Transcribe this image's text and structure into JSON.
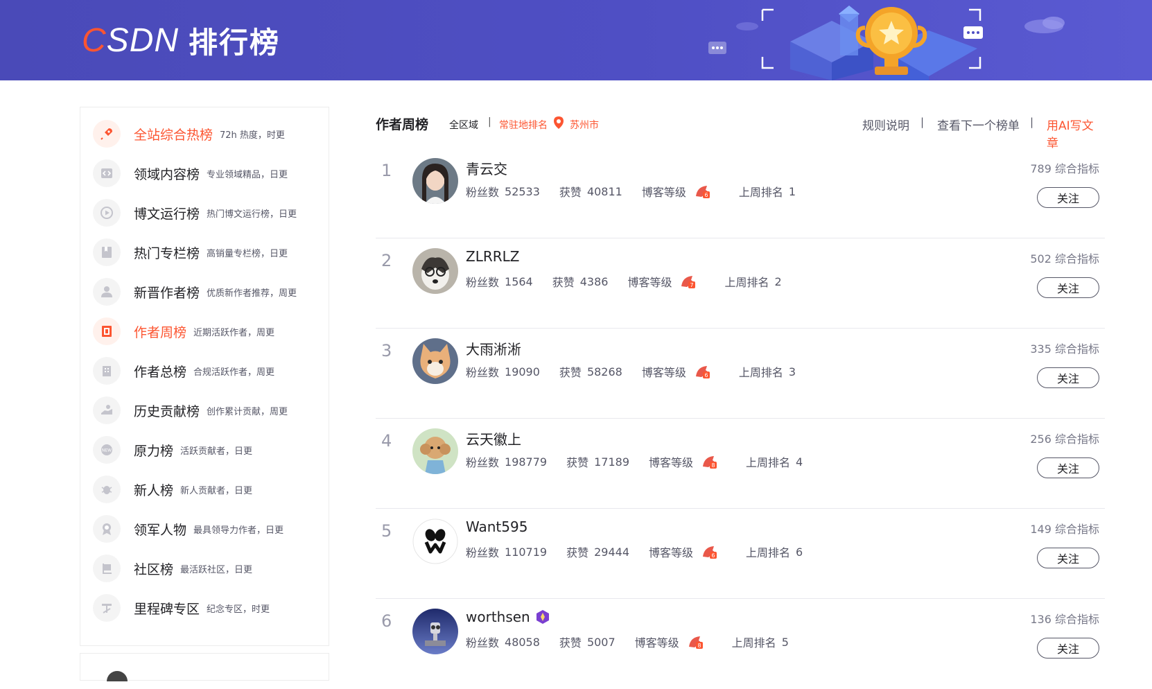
{
  "banner": {
    "logo_c": "C",
    "logo_rest": "SDN",
    "title": "排行榜"
  },
  "sidebar": {
    "items": [
      {
        "label": "全站综合热榜",
        "desc": "72h 热度，时更",
        "icon": "rocket-icon",
        "active": true
      },
      {
        "label": "领域内容榜",
        "desc": "专业领域精品，日更",
        "icon": "code-icon"
      },
      {
        "label": "博文运行榜",
        "desc": "热门博文运行榜，日更",
        "icon": "play-icon"
      },
      {
        "label": "热门专栏榜",
        "desc": "高销量专栏榜，日更",
        "icon": "bookmark-icon"
      },
      {
        "label": "新晋作者榜",
        "desc": "优质新作者推荐，周更",
        "icon": "user-icon"
      },
      {
        "label": "作者周榜",
        "desc": "近期活跃作者，周更",
        "icon": "calendar-icon",
        "active": true
      },
      {
        "label": "作者总榜",
        "desc": "合规活跃作者，周更",
        "icon": "building-icon"
      },
      {
        "label": "历史贡献榜",
        "desc": "创作累计贡献，周更",
        "icon": "hand-icon"
      },
      {
        "label": "原力榜",
        "desc": "活跃贡献者，日更",
        "icon": "new-badge-icon"
      },
      {
        "label": "新人榜",
        "desc": "新人贡献者，日更",
        "icon": "bug-icon"
      },
      {
        "label": "领军人物",
        "desc": "最具领导力作者，日更",
        "icon": "medal-icon"
      },
      {
        "label": "社区榜",
        "desc": "最活跃社区，日更",
        "icon": "flag-icon"
      },
      {
        "label": "里程碑专区",
        "desc": "纪念专区，时更",
        "icon": "milestone-icon"
      }
    ]
  },
  "header": {
    "title": "作者周榜",
    "region": "全区域",
    "separator": "|",
    "local_rank": "常驻地排名",
    "city": "苏州市",
    "rules": "规则说明",
    "next_board": "查看下一个榜单",
    "ai_write": "用AI写文章"
  },
  "labels": {
    "fans": "粉丝数",
    "likes": "获赞",
    "level": "博客等级",
    "last_rank": "上周排名",
    "score_suffix": "综合指标",
    "follow": "关注"
  },
  "rows": [
    {
      "rank": "1",
      "name": "青云交",
      "fans": "52533",
      "likes": "40811",
      "last_rank": "1",
      "score": "789",
      "level": "6"
    },
    {
      "rank": "2",
      "name": "ZLRRLZ",
      "fans": "1564",
      "likes": "4386",
      "last_rank": "2",
      "score": "502",
      "level": "7"
    },
    {
      "rank": "3",
      "name": "大雨淅淅",
      "fans": "19090",
      "likes": "58268",
      "last_rank": "3",
      "score": "335",
      "level": "6"
    },
    {
      "rank": "4",
      "name": "云天徽上",
      "fans": "198779",
      "likes": "17189",
      "last_rank": "4",
      "score": "256",
      "level": "8"
    },
    {
      "rank": "5",
      "name": "Want595",
      "fans": "110719",
      "likes": "29444",
      "last_rank": "6",
      "score": "149",
      "level": "6"
    },
    {
      "rank": "6",
      "name": "worthsen",
      "fans": "48058",
      "likes": "5007",
      "last_rank": "5",
      "score": "136",
      "level": "8",
      "vip": true
    }
  ],
  "colors": {
    "brand": "#fc5531",
    "banner": "#4f4fc4"
  }
}
